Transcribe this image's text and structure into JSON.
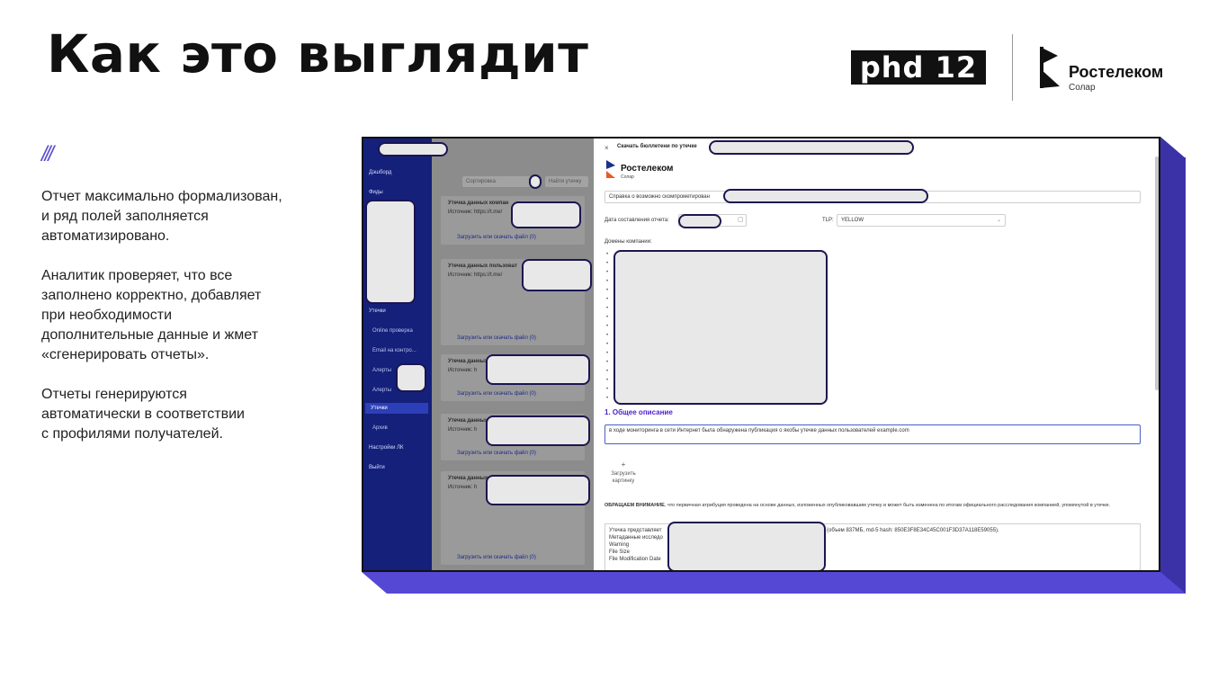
{
  "slide": {
    "title": "Как это выглядит",
    "deco": "///",
    "paragraphs": [
      "Отчет максимально формализован,\nи ряд полей заполняется\nавтоматизировано.",
      "Аналитик проверяет, что все\nзаполнено корректно, добавляет\nпри необходимости\nдополнительные данные и жмет\n«сгенерировать отчеты».",
      "Отчеты генерируются\nавтоматически в соответствии\nс профилями получателей."
    ]
  },
  "brand": {
    "phd": "phd 12",
    "rt_name": "Ростелеком",
    "rt_sub": "Солар"
  },
  "app": {
    "sidebar": {
      "dashboard": "Дэшборд",
      "feeds": "Фиды",
      "leaks": "Утечки",
      "online_check": "Online проверка",
      "email_check": "Email на контро...",
      "alerts1": "Алерты",
      "alerts2": "Алерты",
      "leaks_active": "Утечки",
      "archive": "Архив",
      "settings": "Настройки ЛК",
      "logout": "Выйти"
    },
    "list": {
      "filter1": "Сортировка",
      "filter2": "Найти утечку",
      "cards": [
        {
          "title": "Утечка данных компан",
          "source": "Источник: https://t.me/",
          "link": "Загрузить или скачать файл (0)"
        },
        {
          "title": "Утечка данных пользоват",
          "source": "Источник: https://t.me/",
          "link": "Загрузить или скачать файл (0)"
        },
        {
          "title": "Утечка данных",
          "source": "Источник: h",
          "link": "Загрузить или скачать файл (0)"
        },
        {
          "title": "Утечка данных",
          "source": "Источник: h",
          "link": "Загрузить или скачать файл (0)"
        },
        {
          "title": "Утечка данных",
          "source": "Источник: h",
          "link": "Загрузить или скачать файл (0)"
        }
      ]
    },
    "modal": {
      "close": "×",
      "header": "Скачать бюллетени по утечке",
      "logo_name": "Ростелеком",
      "logo_sub": "Солар",
      "subject": "Справка о возможно скомпрометирован",
      "date_label": "Дата составления отчета:",
      "tlp_label": "TLP:",
      "tlp_value": "YELLOW",
      "domains_label": "Домены компании:",
      "section1": "1. Общее описание",
      "description": "в ходе мониторинга в сети Интернет была обнаружена публикация о якобы утечке данных пользователей example.com",
      "upload_plus": "+",
      "upload_label": "Загрузить картинку",
      "attention_bold": "ОБРАЩАЕМ ВНИМАНИЕ",
      "attention_text": ", что первичная атрибуция проведена на основе данных, изложенных опубликовавшим утечку и может быть изменена по итогам официального расследования компанией, упомянутой в утечке.",
      "file_lines": [
        "Утечка представляет",
        "Метаданные исследо",
        "Warning",
        "File Size",
        "File Modification Date"
      ],
      "hash_text": "(объем 837МБ, md-5 hash: 850E3F8E34C45C001F3D37A118E59055)."
    }
  }
}
